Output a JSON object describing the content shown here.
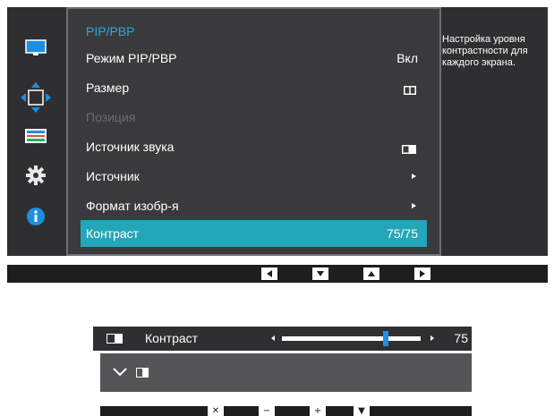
{
  "sidebar": {
    "icons": [
      "monitor-icon",
      "move-arrows-icon",
      "color-icon",
      "gear-icon",
      "info-icon"
    ],
    "selected_index": 1
  },
  "menu": {
    "title": "PIP/PBP",
    "items": [
      {
        "label": "Режим PIP/PBP",
        "value": "Вкл",
        "type": "text"
      },
      {
        "label": "Размер",
        "value": "",
        "type": "pbp-icon"
      },
      {
        "label": "Позиция",
        "value": "",
        "type": "disabled"
      },
      {
        "label": "Источник звука",
        "value": "",
        "type": "sound-icon"
      },
      {
        "label": "Источник",
        "value": "",
        "type": "arrow"
      },
      {
        "label": "Формат изобр-я",
        "value": "",
        "type": "arrow"
      },
      {
        "label": "Контраст",
        "value": "75/75",
        "type": "selected"
      }
    ]
  },
  "help_text": "Настройка уровня контрастности для каждого экрана.",
  "nav_buttons": [
    "left",
    "down",
    "up",
    "right"
  ],
  "slider": {
    "label": "Контраст",
    "value": "75",
    "level": 0.75
  },
  "nav2_buttons": [
    "✕",
    "−",
    "+",
    "▼"
  ],
  "colors": {
    "accent": "#27a9e1",
    "selected_row": "#23a6b9",
    "knob": "#1e90e8"
  }
}
